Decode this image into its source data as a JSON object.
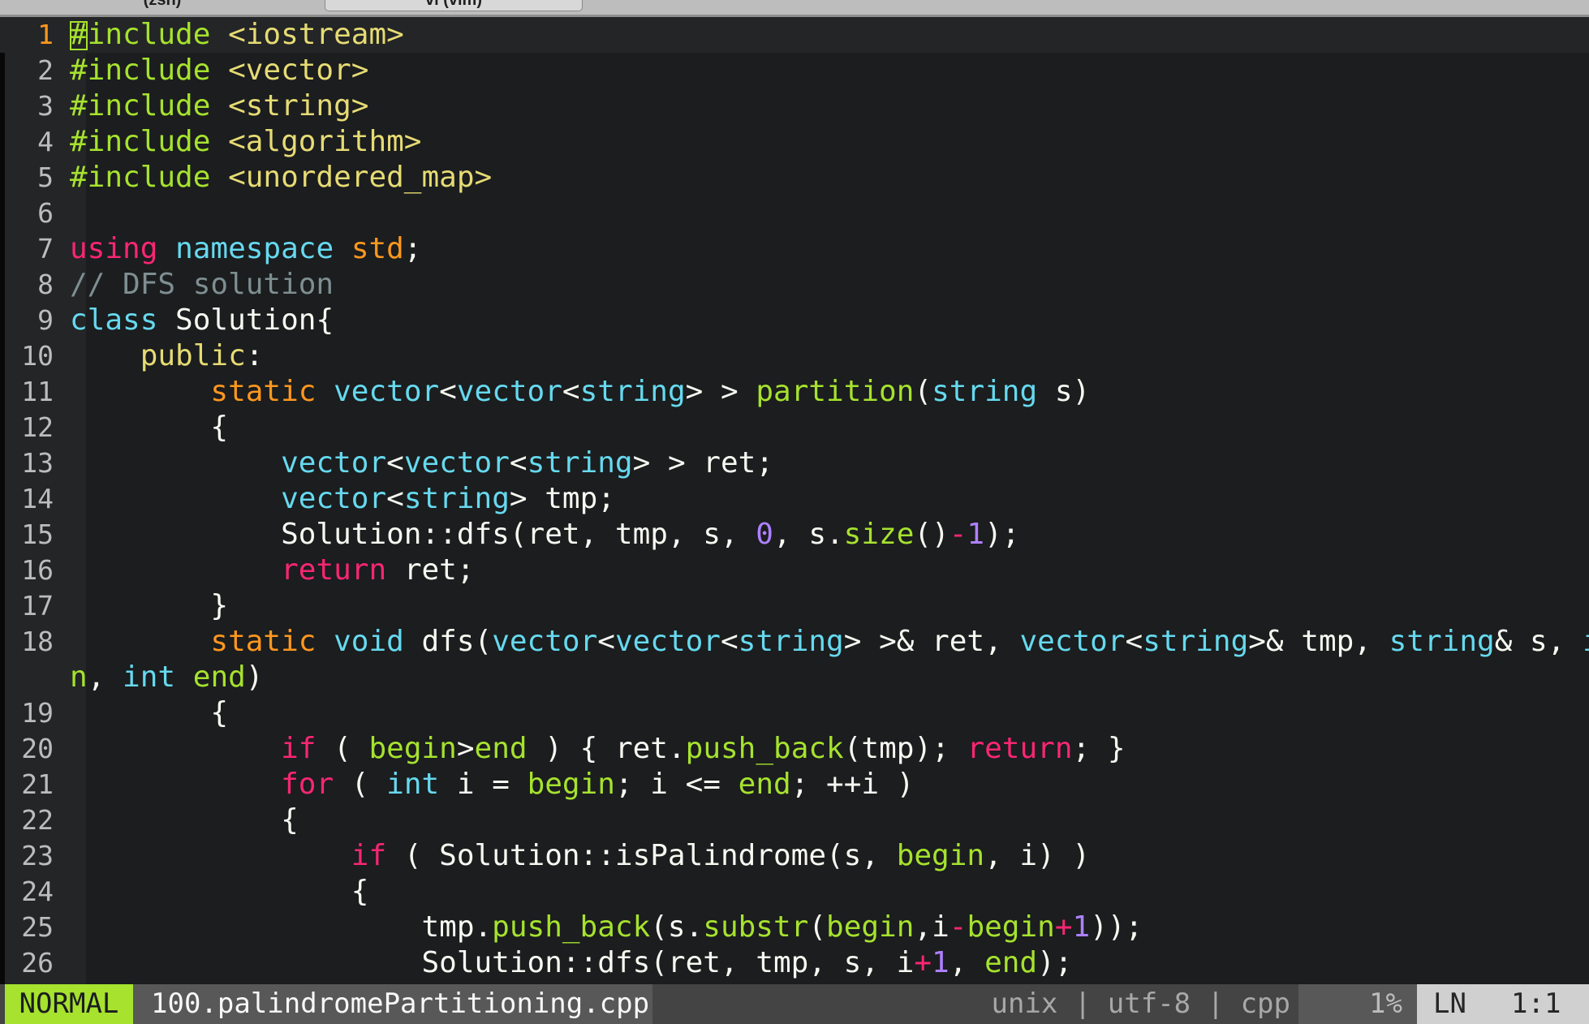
{
  "terminal": {
    "tabs": [
      {
        "label": "(zsh)"
      },
      {
        "label": "vi (vim)"
      }
    ]
  },
  "editor": {
    "current_line": 1,
    "lines": [
      {
        "n": "1",
        "t": [
          [
            "pp",
            "#include"
          ],
          [
            "str",
            " <iostream>"
          ]
        ]
      },
      {
        "n": "2",
        "t": [
          [
            "pp",
            "#include"
          ],
          [
            "str",
            " <vector>"
          ]
        ]
      },
      {
        "n": "3",
        "t": [
          [
            "pp",
            "#include"
          ],
          [
            "str",
            " <string>"
          ]
        ]
      },
      {
        "n": "4",
        "t": [
          [
            "pp",
            "#include"
          ],
          [
            "str",
            " <algorithm>"
          ]
        ]
      },
      {
        "n": "5",
        "t": [
          [
            "pp",
            "#include"
          ],
          [
            "str",
            " <unordered_map>"
          ]
        ]
      },
      {
        "n": "6",
        "t": []
      },
      {
        "n": "7",
        "t": [
          [
            "kw",
            "using"
          ],
          [
            "",
            "",
            " "
          ],
          [
            "ty",
            "namespace"
          ],
          [
            "",
            " "
          ],
          [
            "mo",
            "std"
          ],
          [
            "",
            ";"
          ]
        ]
      },
      {
        "n": "8",
        "t": [
          [
            "cm",
            "// DFS solution"
          ]
        ]
      },
      {
        "n": "9",
        "t": [
          [
            "ty",
            "class"
          ],
          [
            "",
            " Solution{"
          ]
        ]
      },
      {
        "n": "10",
        "t": [
          [
            "",
            "    "
          ],
          [
            "ac",
            "public"
          ],
          [
            "",
            ":"
          ]
        ]
      },
      {
        "n": "11",
        "t": [
          [
            "",
            "        "
          ],
          [
            "var",
            "static"
          ],
          [
            "",
            " "
          ],
          [
            "ty",
            "vector"
          ],
          [
            "",
            "<"
          ],
          [
            "ty",
            "vector"
          ],
          [
            "",
            "<"
          ],
          [
            "ty",
            "string"
          ],
          [
            "",
            "> > "
          ],
          [
            "fn",
            "partition"
          ],
          [
            "",
            "("
          ],
          [
            "ty",
            "string"
          ],
          [
            "",
            " s)"
          ]
        ]
      },
      {
        "n": "12",
        "t": [
          [
            "",
            "        {"
          ]
        ]
      },
      {
        "n": "13",
        "t": [
          [
            "",
            "            "
          ],
          [
            "ty",
            "vector"
          ],
          [
            "",
            "<"
          ],
          [
            "ty",
            "vector"
          ],
          [
            "",
            "<"
          ],
          [
            "ty",
            "string"
          ],
          [
            "",
            "> > ret;"
          ]
        ]
      },
      {
        "n": "14",
        "t": [
          [
            "",
            "            "
          ],
          [
            "ty",
            "vector"
          ],
          [
            "",
            "<"
          ],
          [
            "ty",
            "string"
          ],
          [
            "",
            "> tmp;"
          ]
        ]
      },
      {
        "n": "15",
        "t": [
          [
            "",
            "            Solution::dfs(ret, tmp, s, "
          ],
          [
            "num",
            "0"
          ],
          [
            "",
            ", s."
          ],
          [
            "fn",
            "size"
          ],
          [
            "",
            "()"
          ],
          [
            "op",
            "-"
          ],
          [
            "num",
            "1"
          ],
          [
            "",
            ");"
          ]
        ]
      },
      {
        "n": "16",
        "t": [
          [
            "",
            "            "
          ],
          [
            "kw",
            "return"
          ],
          [
            "",
            " ret;"
          ]
        ]
      },
      {
        "n": "17",
        "t": [
          [
            "",
            "        }"
          ]
        ]
      },
      {
        "n": "18",
        "t": [
          [
            "",
            "        "
          ],
          [
            "var",
            "static"
          ],
          [
            "",
            " "
          ],
          [
            "ty",
            "void"
          ],
          [
            "",
            " dfs("
          ],
          [
            "ty",
            "vector"
          ],
          [
            "",
            "<"
          ],
          [
            "ty",
            "vector"
          ],
          [
            "",
            "<"
          ],
          [
            "ty",
            "string"
          ],
          [
            "",
            "> >& ret, "
          ],
          [
            "ty",
            "vector"
          ],
          [
            "",
            "<"
          ],
          [
            "ty",
            "string"
          ],
          [
            "",
            ">& tmp, "
          ],
          [
            "ty",
            "string"
          ],
          [
            "",
            "& s, "
          ],
          [
            "ty",
            "int"
          ],
          [
            "",
            " "
          ],
          [
            "par",
            "begi"
          ]
        ]
      },
      {
        "n": "",
        "t": [
          [
            "par",
            "n"
          ],
          [
            "",
            ", "
          ],
          [
            "ty",
            "int"
          ],
          [
            "",
            " "
          ],
          [
            "par",
            "end"
          ],
          [
            "",
            ")"
          ]
        ]
      },
      {
        "n": "19",
        "t": [
          [
            "",
            "        {"
          ]
        ]
      },
      {
        "n": "20",
        "t": [
          [
            "",
            "            "
          ],
          [
            "kw",
            "if"
          ],
          [
            "",
            " ( "
          ],
          [
            "par",
            "begin"
          ],
          [
            "",
            ">"
          ],
          [
            "par",
            "end"
          ],
          [
            "",
            " ) { ret."
          ],
          [
            "fn",
            "push_back"
          ],
          [
            "",
            "(tmp); "
          ],
          [
            "kw",
            "return"
          ],
          [
            "",
            "; }"
          ]
        ]
      },
      {
        "n": "21",
        "t": [
          [
            "",
            "            "
          ],
          [
            "kw",
            "for"
          ],
          [
            "",
            " ( "
          ],
          [
            "ty",
            "int"
          ],
          [
            "",
            " i = "
          ],
          [
            "par",
            "begin"
          ],
          [
            "",
            "; i <= "
          ],
          [
            "par",
            "end"
          ],
          [
            "",
            "; ++i )"
          ]
        ]
      },
      {
        "n": "22",
        "t": [
          [
            "",
            "            {"
          ]
        ]
      },
      {
        "n": "23",
        "t": [
          [
            "",
            "                "
          ],
          [
            "kw",
            "if"
          ],
          [
            "",
            " ( Solution::isPalindrome(s, "
          ],
          [
            "par",
            "begin"
          ],
          [
            "",
            ", i) )"
          ]
        ]
      },
      {
        "n": "24",
        "t": [
          [
            "",
            "                {"
          ]
        ]
      },
      {
        "n": "25",
        "t": [
          [
            "",
            "                    tmp."
          ],
          [
            "fn",
            "push_back"
          ],
          [
            "",
            "(s."
          ],
          [
            "fn",
            "substr"
          ],
          [
            "",
            "("
          ],
          [
            "par",
            "begin"
          ],
          [
            "",
            ",i"
          ],
          [
            "op",
            "-"
          ],
          [
            "par",
            "begin"
          ],
          [
            "op",
            "+"
          ],
          [
            "num",
            "1"
          ],
          [
            "",
            "));"
          ]
        ]
      },
      {
        "n": "26",
        "t": [
          [
            "",
            "                    Solution::dfs(ret, tmp, s, i"
          ],
          [
            "op",
            "+"
          ],
          [
            "num",
            "1"
          ],
          [
            "",
            ", "
          ],
          [
            "par",
            "end"
          ],
          [
            "",
            ");"
          ]
        ]
      }
    ]
  },
  "statusbar": {
    "mode": "NORMAL",
    "filename": "100.palindromePartitioning.cpp",
    "fileformat": "unix",
    "encoding": "utf-8",
    "filetype": "cpp",
    "separator": " | ",
    "percent": "1%",
    "ln_label": "LN",
    "position": "1:1"
  },
  "colors": {
    "background": "#1b1d1e",
    "gutter": "#232526",
    "preprocessor": "#a6e22e",
    "string": "#e6db74",
    "keyword": "#f92672",
    "type": "#66d9ef",
    "comment": "#7e8e91",
    "number": "#ae81ff",
    "mode_bg": "#a6e22e"
  }
}
